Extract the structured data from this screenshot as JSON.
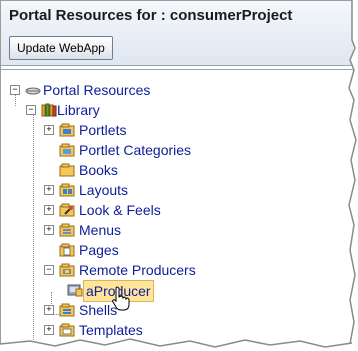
{
  "header": {
    "title": "Portal Resources for : consumerProject",
    "update_button": "Update WebApp"
  },
  "tree": {
    "root": "Portal Resources",
    "library": "Library",
    "items": [
      {
        "label": "Portlets",
        "icon": "portlets-icon",
        "expand": "+"
      },
      {
        "label": "Portlet Categories",
        "icon": "portlet-categories-icon",
        "expand": ""
      },
      {
        "label": "Books",
        "icon": "books-icon",
        "expand": ""
      },
      {
        "label": "Layouts",
        "icon": "layouts-icon",
        "expand": "+"
      },
      {
        "label": "Look & Feels",
        "icon": "look-and-feels-icon",
        "expand": "+"
      },
      {
        "label": "Menus",
        "icon": "menus-icon",
        "expand": "+"
      },
      {
        "label": "Pages",
        "icon": "pages-icon",
        "expand": ""
      },
      {
        "label": "Remote Producers",
        "icon": "remote-producers-icon",
        "expand": "−"
      },
      {
        "label": "Shells",
        "icon": "shells-icon",
        "expand": "+"
      },
      {
        "label": "Templates",
        "icon": "templates-icon",
        "expand": "+"
      }
    ],
    "selected_child": "aProducer"
  },
  "colors": {
    "link": "#10209a",
    "selection": "#ffe59a",
    "folder": "#e8b53a"
  }
}
